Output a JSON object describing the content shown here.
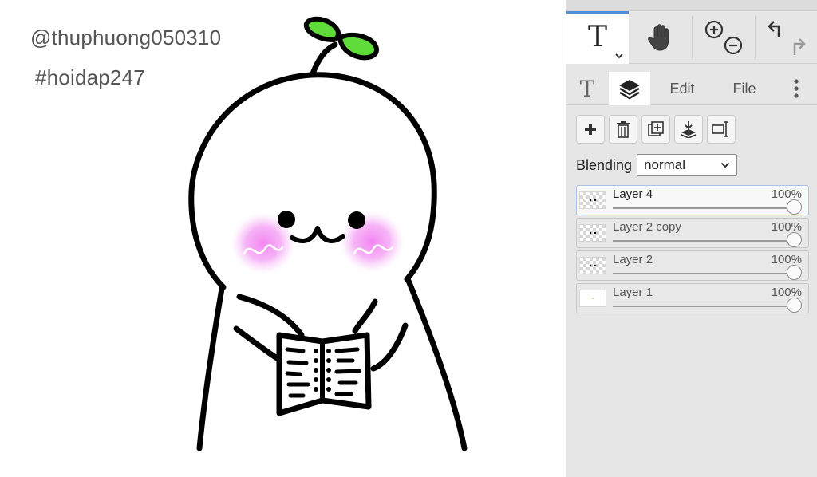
{
  "canvas": {
    "watermark_1": "@thuphuong050310",
    "watermark_2": "#hoidap247"
  },
  "toolbar": {
    "text_tool_glyph": "T",
    "tools": [
      "text-tool",
      "hand-tool",
      "zoom-in-out",
      "undo-redo"
    ]
  },
  "tabs": {
    "text_glyph": "T",
    "edit_label": "Edit",
    "file_label": "File",
    "active": "layers"
  },
  "blending": {
    "label": "Blending",
    "value": "normal"
  },
  "layers": [
    {
      "name": "Layer 4",
      "opacity": "100%",
      "active": true
    },
    {
      "name": "Layer 2 copy",
      "opacity": "100%",
      "active": false
    },
    {
      "name": "Layer 2",
      "opacity": "100%",
      "active": false
    },
    {
      "name": "Layer 1",
      "opacity": "100%",
      "active": false
    }
  ],
  "colors": {
    "accent": "#4f8fd9",
    "sprout": "#5fdc3a",
    "blush": "#f08af0"
  }
}
